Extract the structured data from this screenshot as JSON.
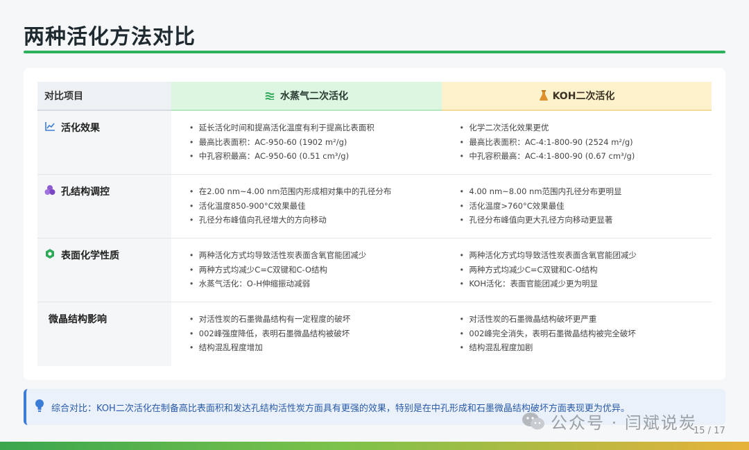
{
  "title": "两种活化方法对比",
  "header": {
    "item": "对比项目",
    "steam": "水蒸气二次活化",
    "koh": "KOH二次活化"
  },
  "rows": [
    {
      "label": "活化效果",
      "icon": "line-chart-icon",
      "steam": [
        "延长活化时间和提高活化温度有利于提高比表面积",
        "最高比表面积：AC-950-60 (1902 m²/g)",
        "中孔容积最高：AC-950-60 (0.51 cm³/g)"
      ],
      "koh": [
        "化学二次活化效果更优",
        "最高比表面积：AC-4:1-800-90 (2524 m²/g)",
        "中孔容积最高：AC-4:1-800-90 (0.67 cm³/g)"
      ]
    },
    {
      "label": "孔结构调控",
      "icon": "cubes-icon",
      "steam": [
        "在2.00 nm~4.00 nm范围内形成相对集中的孔径分布",
        "活化温度850-900°C效果最佳",
        "孔径分布峰值向孔径增大的方向移动"
      ],
      "koh": [
        "4.00 nm~8.00 nm范围内孔径分布更明显",
        "活化温度>760°C效果最佳",
        "孔径分布峰值向更大孔径方向移动更显著"
      ]
    },
    {
      "label": "表面化学性质",
      "icon": "molecule-icon",
      "steam": [
        "两种活化方式均导致活性炭表面含氧官能团减少",
        "两种方式均减少C=C双键和C-O结构",
        "水蒸气活化：O-H伸缩振动减弱"
      ],
      "koh": [
        "两种活化方式均导致活性炭表面含氧官能团减少",
        "两种方式均减少C=C双键和C-O结构",
        "KOH活化：表面官能团减少更为明显"
      ]
    },
    {
      "label": "微晶结构影响",
      "icon": "",
      "steam": [
        "对活性炭的石墨微晶结构有一定程度的破坏",
        "002峰强度降低，表明石墨微晶结构被破坏",
        "结构混乱程度增加"
      ],
      "koh": [
        "对活性炭的石墨微晶结构破坏更严重",
        "002峰完全消失，表明石墨微晶结构被完全破坏",
        "结构混乱程度加剧"
      ]
    }
  ],
  "summary": "综合对比：KOH二次活化在制备高比表面积和发达孔结构活性炭方面具有更强的效果，特别是在中孔形成和石墨微晶结构破坏方面表现更为优异。",
  "watermark": "公众号 · 闫斌说炭",
  "page": "15 / 17",
  "colors": {
    "accent_green": "#2fb05a",
    "steam_header_bg": "#dcf6e2",
    "koh_header_bg": "#fdf2cc",
    "summary_text": "#2a5aa8"
  }
}
